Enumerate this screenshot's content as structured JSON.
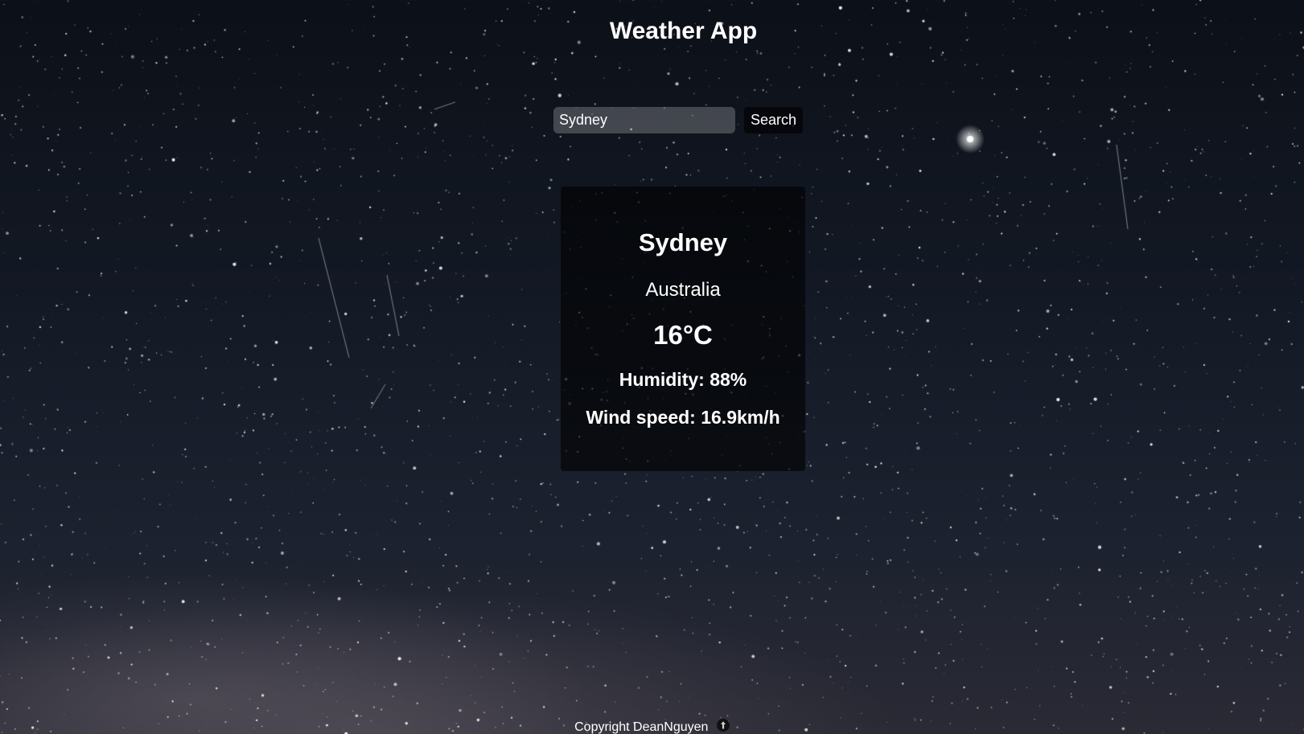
{
  "app": {
    "title": "Weather App"
  },
  "search": {
    "value": "Sydney",
    "button_label": "Search"
  },
  "weather": {
    "city": "Sydney",
    "country": "Australia",
    "temperature": "16°C",
    "humidity": "Humidity: 88%",
    "wind_speed": "Wind speed: 16.9km/h"
  },
  "footer": {
    "copyright": "Copyright DeanNguyen",
    "icon": "github-icon"
  }
}
